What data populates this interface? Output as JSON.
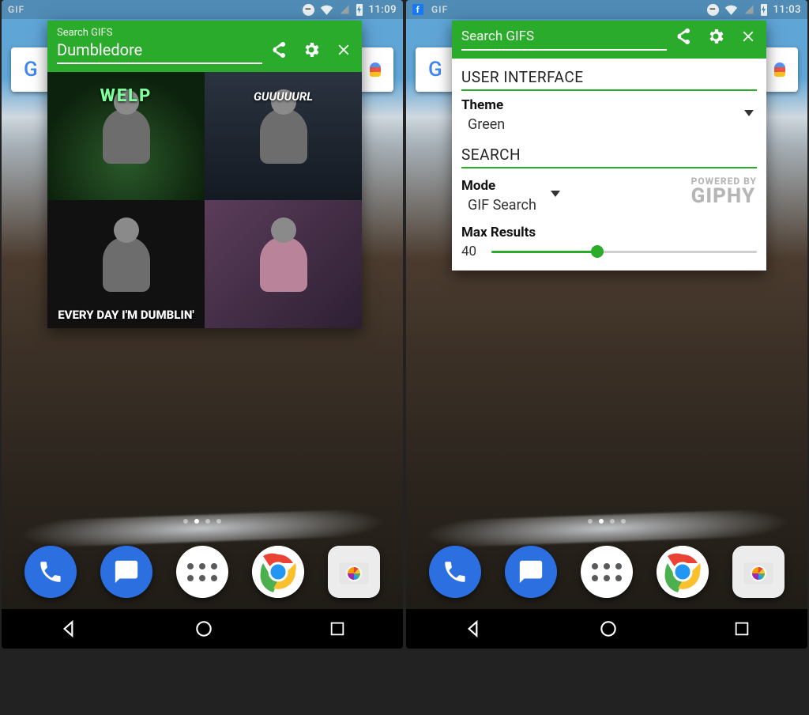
{
  "left": {
    "status": {
      "indicator": "GIF",
      "time": "11:09"
    },
    "popup": {
      "search_label": "Search GIFS",
      "search_value": "Dumbledore",
      "results": [
        {
          "caption": "WELP"
        },
        {
          "caption": "GUUUUURL"
        },
        {
          "caption": "EVERY DAY I'M DUMBLIN'"
        },
        {
          "caption": ""
        }
      ]
    }
  },
  "right": {
    "status": {
      "indicator": "GIF",
      "time": "11:03"
    },
    "popup": {
      "search_label": "Search GIFS",
      "search_value": "",
      "section_ui": "USER INTERFACE",
      "theme_label": "Theme",
      "theme_value": "Green",
      "section_search": "SEARCH",
      "mode_label": "Mode",
      "mode_value": "GIF Search",
      "giphy_powered": "POWERED BY",
      "giphy_brand": "GIPHY",
      "max_label": "Max Results",
      "max_value": "40",
      "max_percent": 40
    }
  },
  "dock": {
    "apps": [
      "phone",
      "messages",
      "app-drawer",
      "chrome",
      "camera"
    ]
  }
}
